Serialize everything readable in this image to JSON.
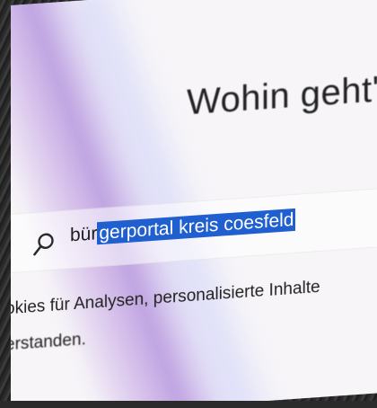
{
  "page": {
    "headline": "Wohin geht's",
    "search": {
      "typed_text": "bür",
      "selected_text": "gerportal kreis coesfeld",
      "icon": "search-icon"
    },
    "cookie_notice": {
      "line1": "okies für Analysen, personalisierte Inhalte",
      "line2": "erstanden."
    }
  },
  "colors": {
    "selection": "#1f5fd0",
    "text": "#1c1c1c",
    "screen_bg": "#f7f5f8"
  }
}
